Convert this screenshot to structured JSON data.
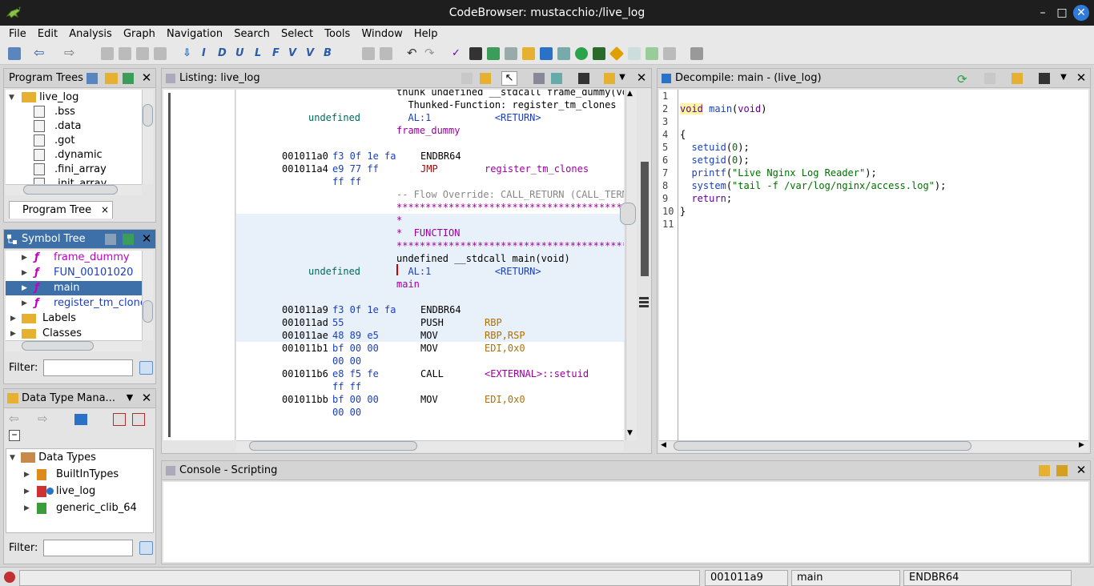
{
  "window": {
    "title": "CodeBrowser: mustacchio:/live_log"
  },
  "menubar": [
    "File",
    "Edit",
    "Analysis",
    "Graph",
    "Navigation",
    "Search",
    "Select",
    "Tools",
    "Window",
    "Help"
  ],
  "program_trees": {
    "title": "Program Trees",
    "root": "live_log",
    "items": [
      ".bss",
      ".data",
      ".got",
      ".dynamic",
      ".fini_array",
      ".init_array"
    ],
    "tab": "Program Tree",
    "tab_close": "×"
  },
  "symbol_tree": {
    "title": "Symbol Tree",
    "items": [
      "frame_dummy",
      "FUN_00101020",
      "main",
      "register_tm_clones"
    ],
    "folders": [
      "Labels",
      "Classes"
    ],
    "filter_label": "Filter:"
  },
  "data_type_manager": {
    "title": "Data Type Mana...",
    "root": "Data Types",
    "items": [
      "BuiltInTypes",
      "live_log",
      "generic_clib_64"
    ],
    "filter_label": "Filter:"
  },
  "listing": {
    "title": "Listing:  live_log",
    "rows": [
      {
        "col1": "",
        "col2": "",
        "col3": "thunk undefined __stdcall frame_dummy(voi",
        "style": "header"
      },
      {
        "col1": "",
        "col2": "",
        "col3": "  Thunked-Function: register_tm_clones",
        "style": "header"
      },
      {
        "col1": "undefined",
        "col2": "",
        "col3": "  AL:1           <RETURN>",
        "style": "ret"
      },
      {
        "col1": "",
        "col2": "",
        "col3": "frame_dummy",
        "style": "label"
      },
      {
        "col1": "",
        "col2": "",
        "col3": "",
        "style": "blank"
      },
      {
        "col1": "001011a0",
        "col2": "f3 0f 1e fa",
        "col3": "ENDBR64",
        "col4": "",
        "style": "code"
      },
      {
        "col1": "001011a4",
        "col2": "e9 77 ff",
        "col3": "JMP",
        "col4": "register_tm_clones",
        "style": "jmp"
      },
      {
        "col1": "",
        "col2": "ff ff",
        "col3": "",
        "style": "cont"
      },
      {
        "col1": "",
        "col2": "",
        "col3": "-- Flow Override: CALL_RETURN (CALL_TERMI",
        "style": "override"
      },
      {
        "col1": "",
        "col2": "",
        "col3": "******************************************",
        "style": "stars"
      },
      {
        "col1": "",
        "col2": "",
        "col3": "*",
        "style": "stars"
      },
      {
        "col1": "",
        "col2": "",
        "col3": "*  FUNCTION",
        "style": "stars"
      },
      {
        "col1": "",
        "col2": "",
        "col3": "******************************************",
        "style": "stars"
      },
      {
        "col1": "",
        "col2": "",
        "col3": "undefined __stdcall main(void)",
        "style": "sig"
      },
      {
        "col1": "undefined",
        "col2": "",
        "col3": "  AL:1           <RETURN>",
        "style": "ret"
      },
      {
        "col1": "",
        "col2": "",
        "col3": "main",
        "style": "label"
      },
      {
        "col1": "",
        "col2": "",
        "col3": "",
        "style": "blank"
      },
      {
        "col1": "001011a9",
        "col2": "f3 0f 1e fa",
        "col3": "ENDBR64",
        "col4": "",
        "style": "code"
      },
      {
        "col1": "001011ad",
        "col2": "55",
        "col3": "PUSH",
        "col4": "RBP",
        "style": "code"
      },
      {
        "col1": "001011ae",
        "col2": "48 89 e5",
        "col3": "MOV",
        "col4": "RBP,RSP",
        "style": "code"
      },
      {
        "col1": "001011b1",
        "col2": "bf 00 00",
        "col3": "MOV",
        "col4": "EDI,0x0",
        "style": "code"
      },
      {
        "col1": "",
        "col2": "00 00",
        "col3": "",
        "style": "cont"
      },
      {
        "col1": "001011b6",
        "col2": "e8 f5 fe",
        "col3": "CALL",
        "col4": "<EXTERNAL>::setuid",
        "style": "call"
      },
      {
        "col1": "",
        "col2": "ff ff",
        "col3": "",
        "style": "cont"
      },
      {
        "col1": "001011bb",
        "col2": "bf 00 00",
        "col3": "MOV",
        "col4": "EDI,0x0",
        "style": "code"
      },
      {
        "col1": "",
        "col2": "00 00",
        "col3": "",
        "style": "cont"
      }
    ]
  },
  "decompile": {
    "title": "Decompile: main -  (live_log)",
    "line_numbers": [
      "1",
      "2",
      "3",
      "4",
      "5",
      "6",
      "7",
      "8",
      "9",
      "10",
      "11"
    ],
    "lines": [
      "",
      "void main(void)",
      "",
      "{",
      "  setuid(0);",
      "  setgid(0);",
      "  printf(\"Live Nginx Log Reader\");",
      "  system(\"tail -f /var/log/nginx/access.log\");",
      "  return;",
      "}",
      ""
    ]
  },
  "console": {
    "title": "Console - Scripting"
  },
  "statusbar": {
    "address": "001011a9",
    "function": "main",
    "instruction": "ENDBR64"
  },
  "colors": {
    "accent": "#3d6fa8",
    "highlight": "#e8f0fa",
    "selection": "#3d6fa8"
  }
}
